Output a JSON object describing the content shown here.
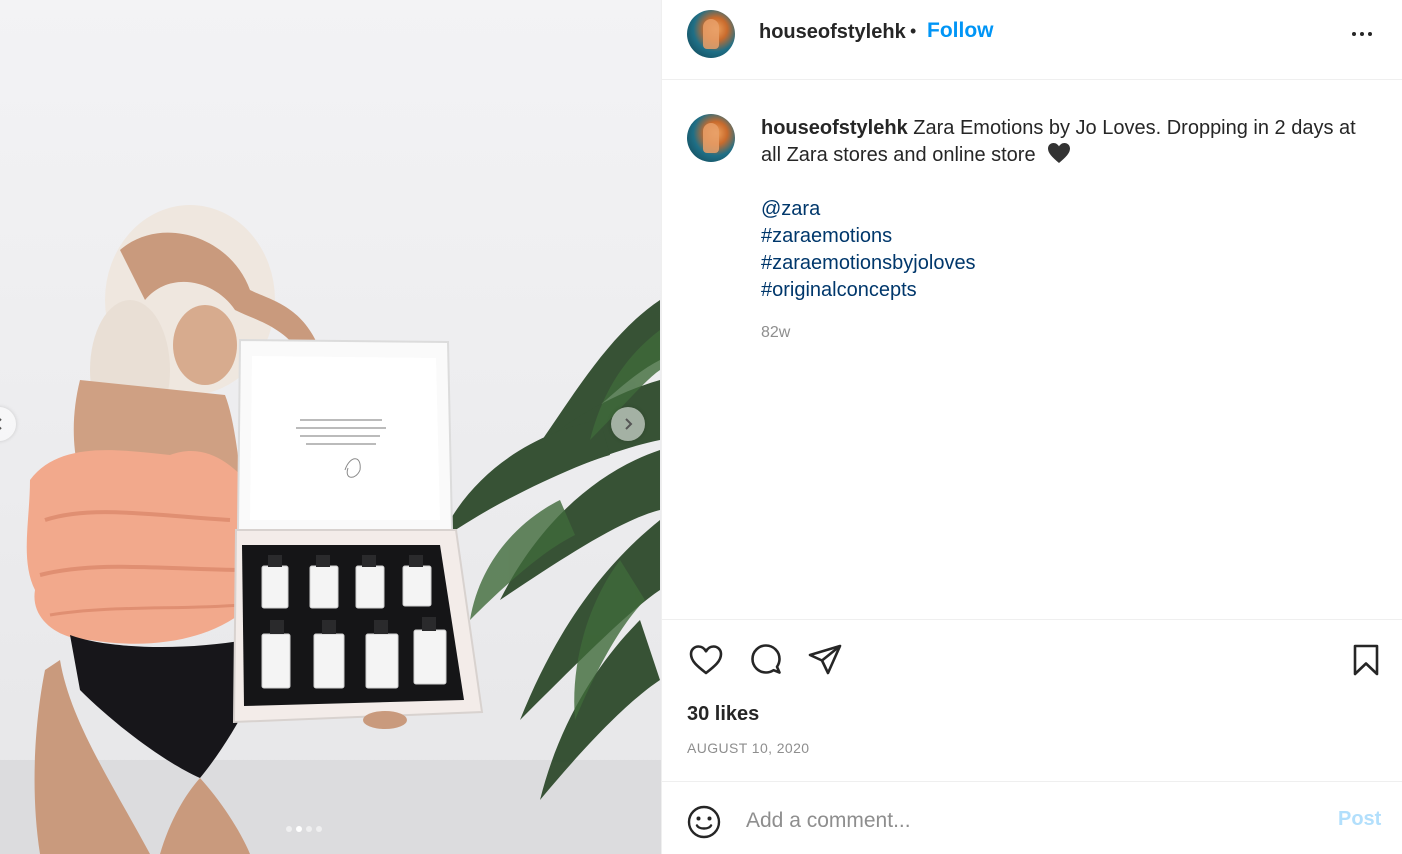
{
  "post": {
    "username": "houseofstylehk",
    "bullet": "•",
    "follow_label": "Follow",
    "caption": {
      "username": "houseofstylehk",
      "text": "Zara Emotions by Jo Loves. Dropping in 2 days at all Zara stores and online store",
      "emoji": "black-heart",
      "tags": [
        "@zara",
        "#zaraemotions",
        "#zaraemotionsbyjoloves",
        "#originalconcepts"
      ],
      "time_ago": "82w"
    },
    "likes": "30 likes",
    "date": "AUGUST 10, 2020",
    "comment": {
      "placeholder": "Add a comment...",
      "post_label": "Post"
    },
    "carousel": {
      "slides": 4,
      "active_slide": 2
    }
  },
  "icons": {
    "more": "more-horizontal-icon",
    "like": "heart-outline-icon",
    "comment": "comment-bubble-icon",
    "share": "paper-plane-icon",
    "save": "bookmark-icon",
    "emoji": "smiley-icon",
    "prev": "chevron-left-icon",
    "next": "chevron-right-icon"
  },
  "colors": {
    "link_blue": "#0095f6",
    "hashtag": "#00376b",
    "muted": "#8e8e8e",
    "post_disabled": "#b2dffc",
    "text": "#262626"
  }
}
